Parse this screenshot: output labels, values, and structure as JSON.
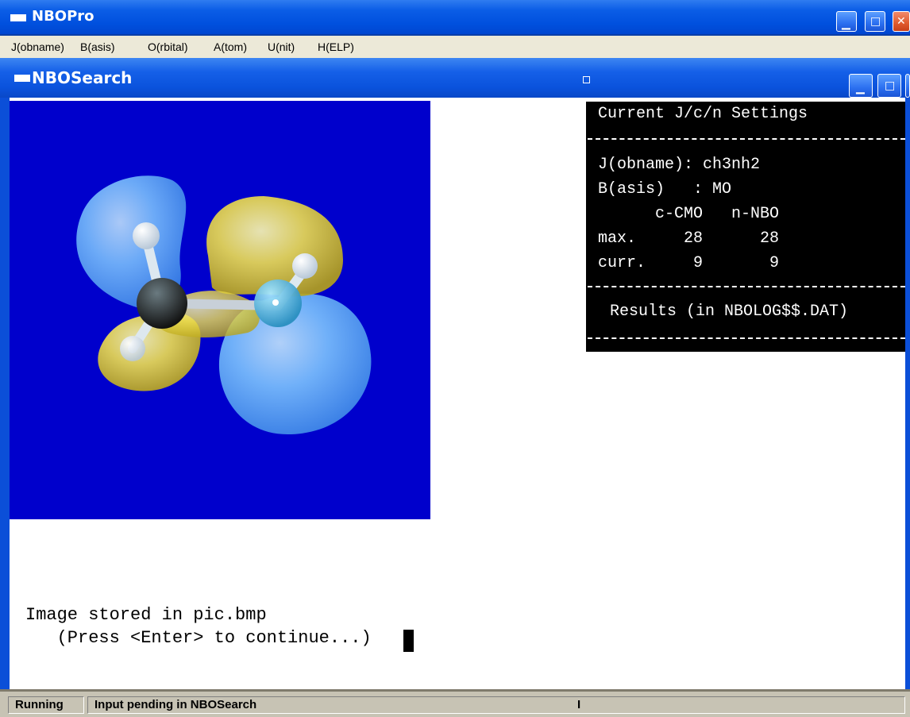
{
  "app": {
    "title": "NBOPro",
    "menu": [
      "J(obname)",
      "B(asis)",
      "O(rbital)",
      "A(tom)",
      "U(nit)",
      "H(ELP)"
    ]
  },
  "child_window": {
    "title": "NBOSearch"
  },
  "settings_panel": {
    "heading": "Current J/c/n Settings",
    "jobname_line": "J(obname): ch3nh2",
    "basis_line": "B(asis)   : MO",
    "columns_line": "      c-CMO   n-NBO",
    "max_line": "max.     28      28",
    "curr_line": "curr.     9       9",
    "results": "Results (in NBOLOG$$.DAT)"
  },
  "console": {
    "line1": "Image stored in pic.bmp",
    "line2": "   (Press <Enter> to continue...)"
  },
  "statusbar": {
    "state": "Running",
    "message": "Input pending in NBOSearch",
    "indicator": "I"
  },
  "colors": {
    "viewport_bg": "#0000cc",
    "lobe_positive": "#7fc8ff",
    "lobe_negative": "#f0e050",
    "title_bar": "#0054e3"
  },
  "icons": {
    "minimize": "minimize-icon",
    "maximize": "maximize-icon",
    "close": "close-icon",
    "window": "window-icon"
  }
}
